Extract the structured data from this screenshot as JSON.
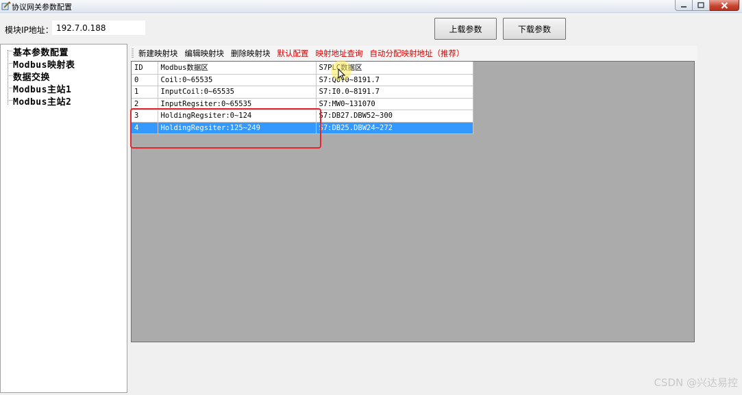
{
  "window": {
    "title": "协议网关参数配置"
  },
  "header": {
    "ip_label": "模块IP地址：",
    "ip_value": "192.7.0.188",
    "upload_button": "上载参数",
    "download_button": "下载参数"
  },
  "tree": {
    "items": [
      "基本参数配置",
      "Modbus映射表",
      "数据交换",
      "Modbus主站1",
      "Modbus主站2"
    ]
  },
  "toolbar": {
    "new_block": "新建映射块",
    "edit_block": "编辑映射块",
    "delete_block": "删除映射块",
    "default_config": "默认配置",
    "query_address": "映射地址查询",
    "auto_assign": "自动分配映射地址（推荐）"
  },
  "table": {
    "headers": [
      "ID",
      "Modbus数据区",
      "S7PLC数据区"
    ],
    "rows": [
      {
        "id": "0",
        "modbus": "Coil:0~65535",
        "s7": "S7:Q0.0~8191.7"
      },
      {
        "id": "1",
        "modbus": "InputCoil:0~65535",
        "s7": "S7:I0.0~8191.7"
      },
      {
        "id": "2",
        "modbus": "InputRegsiter:0~65535",
        "s7": "S7:MW0~131070"
      },
      {
        "id": "3",
        "modbus": "HoldingRegsiter:0~124",
        "s7": "S7:DB27.DBW52~300"
      },
      {
        "id": "4",
        "modbus": "HoldingRegsiter:125~249",
        "s7": "S7:DB25.DBW24~272"
      }
    ],
    "selected_row_id": "4"
  },
  "colors": {
    "selection": "#3399ff",
    "annotation_box": "#e3262b",
    "toolbar_red": "#d40000",
    "grid_background": "#ababab"
  },
  "watermark": "CSDN @兴达易控"
}
